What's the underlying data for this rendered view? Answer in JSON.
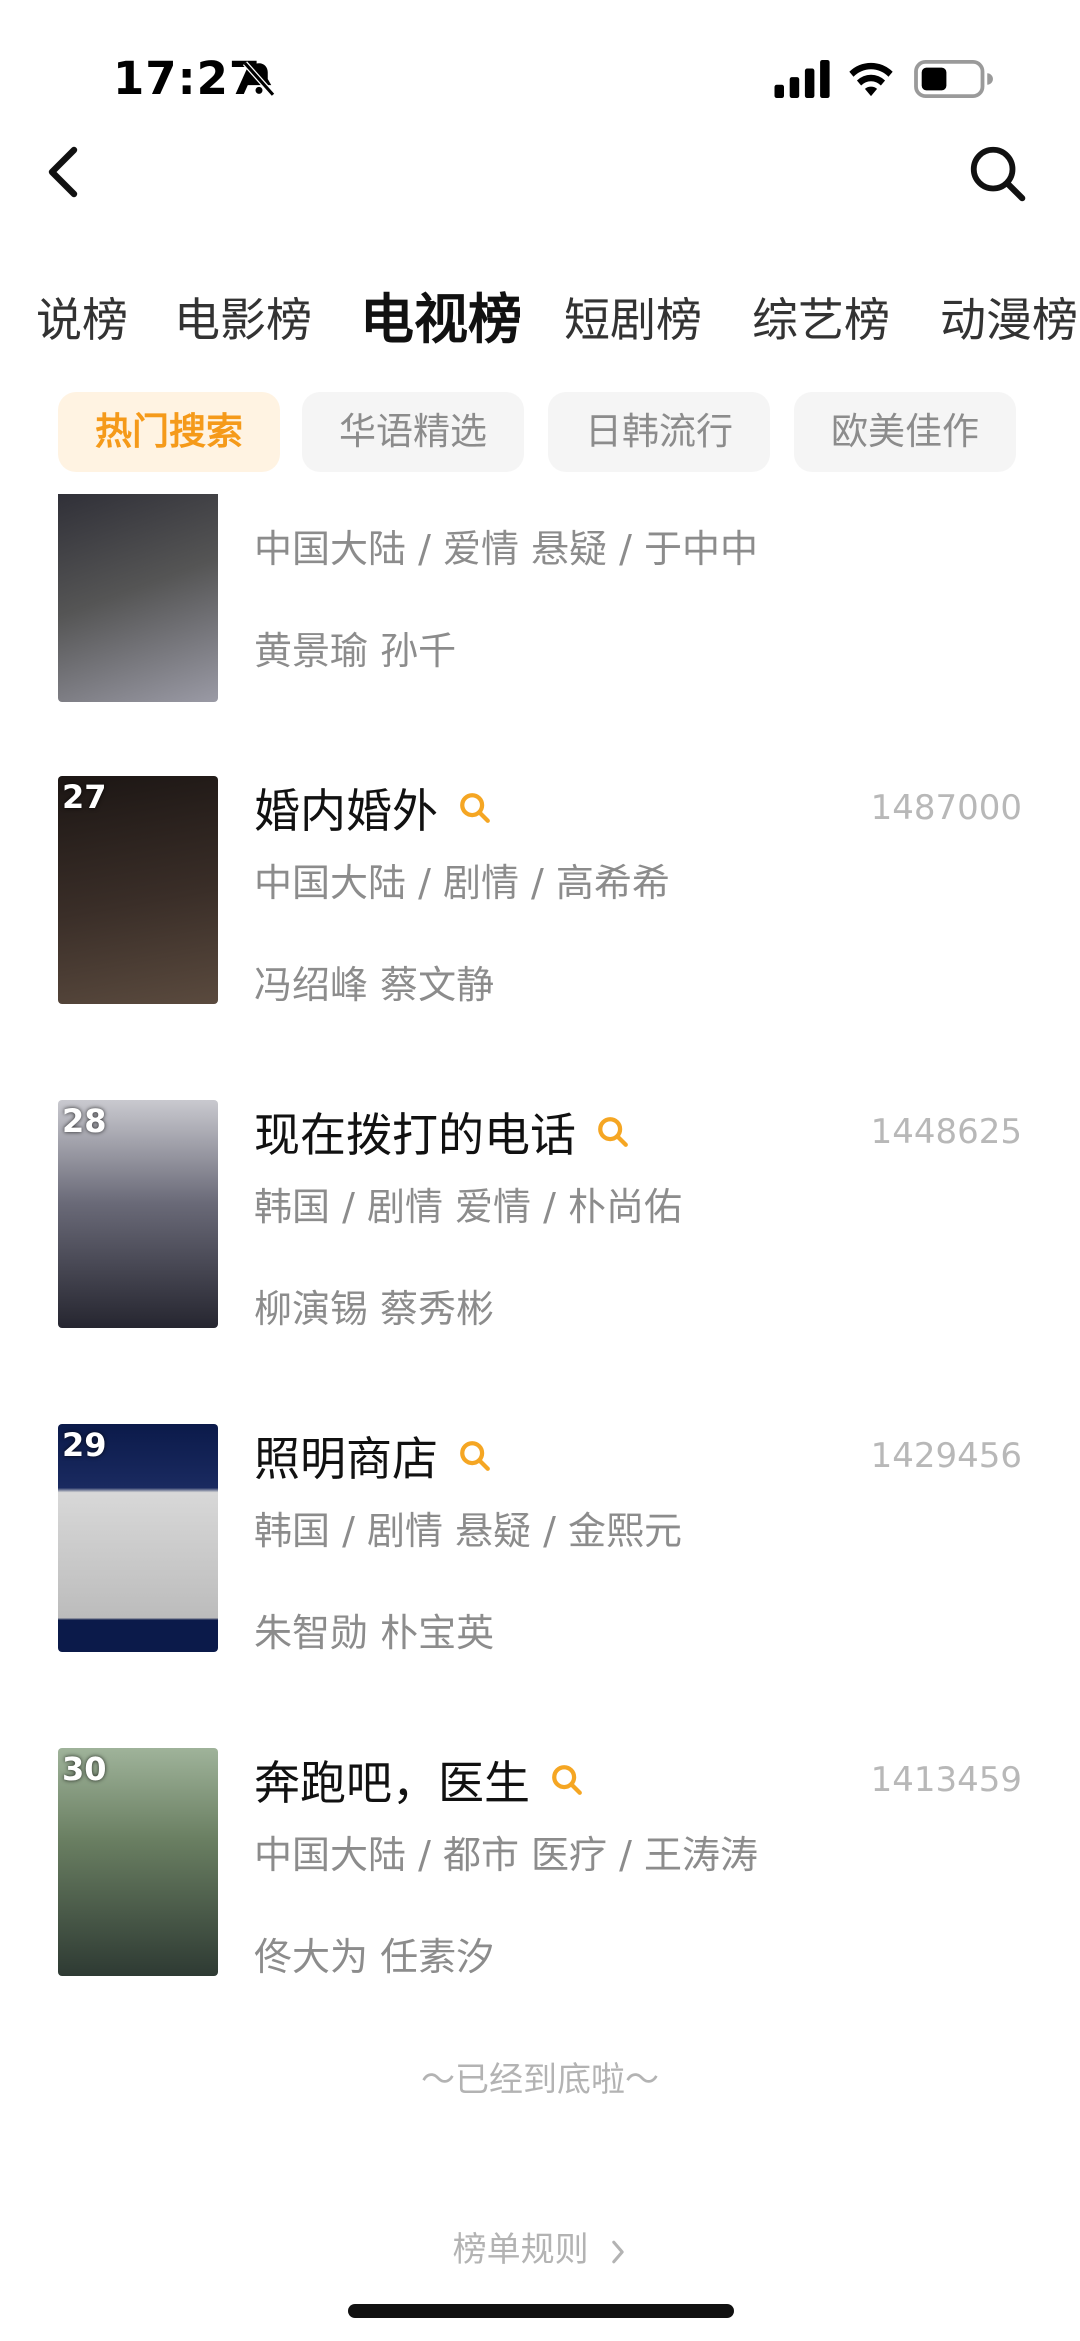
{
  "status": {
    "time": "17:27"
  },
  "category_tabs": [
    "说榜",
    "电影榜",
    "电视榜",
    "短剧榜",
    "综艺榜",
    "动漫榜"
  ],
  "sub_tabs": [
    "热门搜索",
    "华语精选",
    "日韩流行",
    "欧美佳作"
  ],
  "items": [
    {
      "rank": "",
      "title": "",
      "score": "",
      "meta": "中国大陆 / 爱情 悬疑 / 于中中",
      "cast": "黄景瑜 孙千",
      "colors": [
        "#3a3a44",
        "#7a7a86"
      ]
    },
    {
      "rank": "27",
      "title": "婚内婚外",
      "score": "1487000",
      "meta": "中国大陆 / 剧情 / 高希希",
      "cast": "冯绍峰 蔡文静",
      "colors": [
        "#1c1614",
        "#5a4a3e"
      ]
    },
    {
      "rank": "28",
      "title": "现在拨打的电话",
      "score": "1448625",
      "meta": "韩国 / 剧情 爱情 / 朴尚佑",
      "cast": "柳演锡 蔡秀彬",
      "colors": [
        "#c9c9cf",
        "#262630"
      ]
    },
    {
      "rank": "29",
      "title": "照明商店",
      "score": "1429456",
      "meta": "韩国 / 剧情 悬疑 / 金熙元",
      "cast": "朱智勋 朴宝英",
      "colors": [
        "#0b1a4a",
        "#d8d8d8"
      ]
    },
    {
      "rank": "30",
      "title": "奔跑吧，医生",
      "score": "1413459",
      "meta": "中国大陆 / 都市 医疗 / 王涛涛",
      "cast": "佟大为 任素汐",
      "colors": [
        "#6a7f62",
        "#2e3a33"
      ]
    }
  ],
  "end_text": "～已经到底啦～",
  "rules_link": "榜单规则",
  "icons": [
    "bell-off-icon",
    "signal-icon",
    "wifi-icon",
    "battery-icon",
    "back-icon",
    "search-icon",
    "chevron-right-icon"
  ],
  "accent_color": "#f59a1a"
}
